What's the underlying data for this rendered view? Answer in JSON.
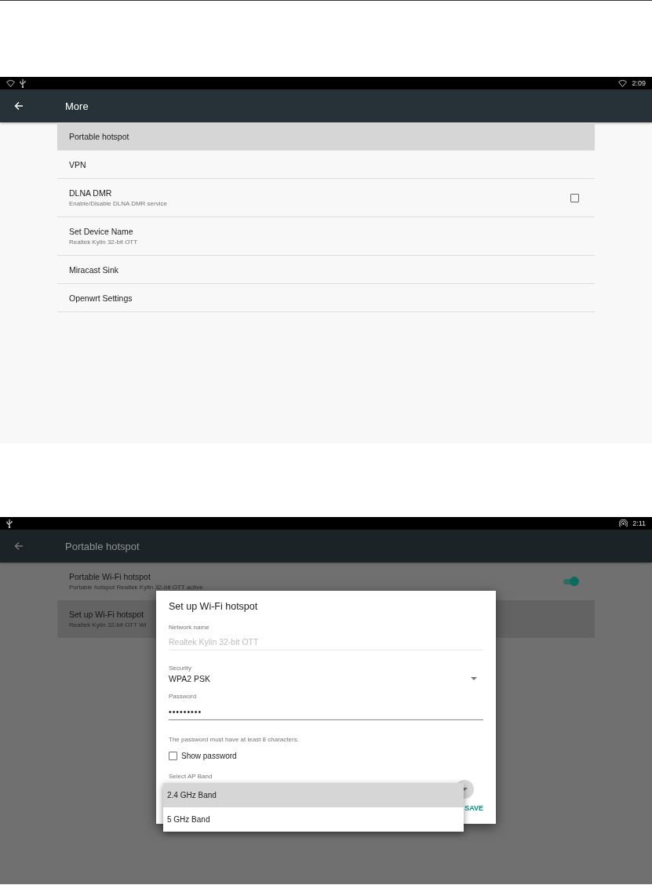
{
  "screens": [
    {
      "status_bar": {
        "time": "2:09"
      },
      "app_bar": {
        "title": "More"
      },
      "items": [
        {
          "kind": "plain",
          "title": "Portable hotspot",
          "selected": true
        },
        {
          "kind": "plain",
          "title": "VPN",
          "selected": false
        },
        {
          "kind": "checkbox",
          "title": "DLNA DMR",
          "subtitle": "Enable/Disable DLNA DMR service",
          "checked": false,
          "selected": false
        },
        {
          "kind": "plain",
          "title": "Set Device Name",
          "subtitle": "Realtek Kylin 32-bit OTT",
          "selected": false
        },
        {
          "kind": "plain",
          "title": "Miracast Sink",
          "selected": false
        },
        {
          "kind": "plain",
          "title": "Openwrt Settings",
          "selected": false
        }
      ]
    },
    {
      "status_bar": {
        "time": "2:11"
      },
      "app_bar": {
        "title": "Portable hotspot"
      },
      "items": [
        {
          "kind": "switch",
          "title": "Portable Wi-Fi hotspot",
          "subtitle": "Portable hotspot Realtek Kylin 32-bit OTT active",
          "on": true,
          "selected": false
        },
        {
          "kind": "plain",
          "title": "Set up Wi-Fi hotspot",
          "subtitle": "Realtek Kylin 32-bit OTT Wi",
          "selected": true
        }
      ],
      "dialog": {
        "title": "Set up Wi-Fi hotspot",
        "network_name": {
          "label": "Network name",
          "value": "Realtek Kylin 32-bit OTT",
          "disabled": true
        },
        "security": {
          "label": "Security",
          "value": "WPA2 PSK"
        },
        "password": {
          "label": "Password",
          "value": "•••••••••"
        },
        "hint": "The password must have at least 8 characters.",
        "show_password": {
          "label": "Show password",
          "checked": false
        },
        "ap_band": {
          "label": "Select AP Band",
          "options": [
            {
              "label": "2.4 GHz Band",
              "selected": true
            },
            {
              "label": "5 GHz Band",
              "selected": false
            }
          ]
        },
        "buttons": [
          "SAVE"
        ]
      }
    }
  ]
}
